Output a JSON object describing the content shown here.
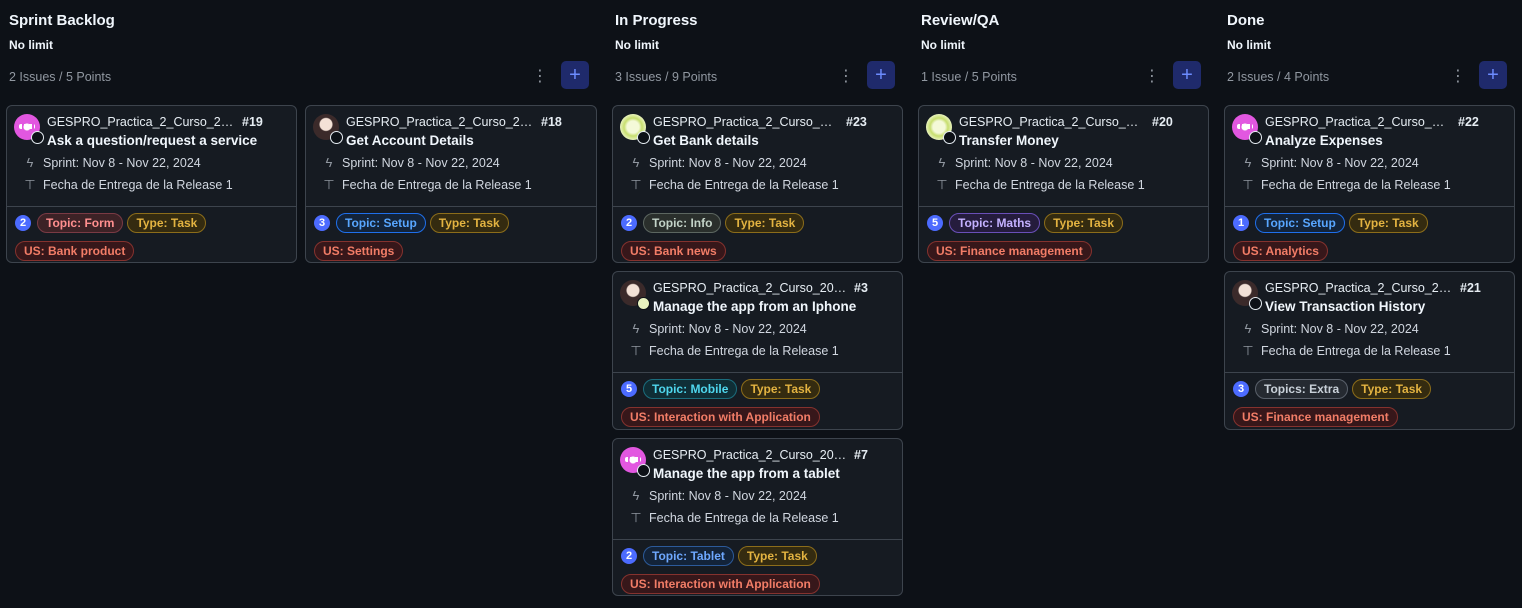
{
  "columns": [
    {
      "title": "Sprint Backlog",
      "limit": "No limit",
      "count": "2 Issues / 5 Points",
      "menu_icon": "kebab-menu-icon",
      "add_icon": "plus-icon",
      "cards": [
        {
          "repo": "GESPRO_Practica_2_Curso_202...",
          "number": "#19",
          "title": "Ask a question/request a service",
          "sprint": "Sprint: Nov 8 - Nov 22, 2024",
          "release": "Fecha de Entrega de la Release 1",
          "points": "2",
          "topic": "Topic: Form",
          "type": "Type: Task",
          "us": "US: Bank product"
        },
        {
          "repo": "GESPRO_Practica_2_Curso_202...",
          "number": "#18",
          "title": "Get Account Details",
          "sprint": "Sprint: Nov 8 - Nov 22, 2024",
          "release": "Fecha de Entrega de la Release 1",
          "points": "3",
          "topic": "Topic: Setup",
          "type": "Type: Task",
          "us": "US: Settings"
        }
      ]
    },
    {
      "title": "In Progress",
      "limit": "No limit",
      "count": "3 Issues / 9 Points",
      "cards": [
        {
          "repo": "GESPRO_Practica_2_Curso_20...",
          "number": "#23",
          "title": "Get Bank details",
          "sprint": "Sprint: Nov 8 - Nov 22, 2024",
          "release": "Fecha de Entrega de la Release 1",
          "points": "2",
          "topic": "Topic: Info",
          "type": "Type: Task",
          "us": "US: Bank news"
        },
        {
          "repo": "GESPRO_Practica_2_Curso_2024...",
          "number": "#3",
          "title": "Manage the app from an Iphone",
          "sprint": "Sprint: Nov 8 - Nov 22, 2024",
          "release": "Fecha de Entrega de la Release 1",
          "points": "5",
          "topic": "Topic: Mobile",
          "type": "Type: Task",
          "us": "US: Interaction with Application"
        },
        {
          "repo": "GESPRO_Practica_2_Curso_2024...",
          "number": "#7",
          "title": "Manage the app from a tablet",
          "sprint": "Sprint: Nov 8 - Nov 22, 2024",
          "release": "Fecha de Entrega de la Release 1",
          "points": "2",
          "topic": "Topic: Tablet",
          "type": "Type: Task",
          "us": "US: Interaction with Application"
        }
      ]
    },
    {
      "title": "Review/QA",
      "limit": "No limit",
      "count": "1 Issue / 5 Points",
      "cards": [
        {
          "repo": "GESPRO_Practica_2_Curso_20...",
          "number": "#20",
          "title": "Transfer Money",
          "sprint": "Sprint: Nov 8 - Nov 22, 2024",
          "release": "Fecha de Entrega de la Release 1",
          "points": "5",
          "topic": "Topic: Maths",
          "type": "Type: Task",
          "us": "US: Finance management"
        }
      ]
    },
    {
      "title": "Done",
      "limit": "No limit",
      "count": "2 Issues / 4 Points",
      "cards": [
        {
          "repo": "GESPRO_Practica_2_Curso_20...",
          "number": "#22",
          "title": "Analyze Expenses",
          "sprint": "Sprint: Nov 8 - Nov 22, 2024",
          "release": "Fecha de Entrega de la Release 1",
          "points": "1",
          "topic": "Topic: Setup",
          "type": "Type: Task",
          "us": "US: Analytics"
        },
        {
          "repo": "GESPRO_Practica_2_Curso_202...",
          "number": "#21",
          "title": "View Transaction History",
          "sprint": "Sprint: Nov 8 - Nov 22, 2024",
          "release": "Fecha de Entrega de la Release 1",
          "points": "3",
          "topic": "Topics: Extra",
          "type": "Type: Task",
          "us": "US: Finance management"
        }
      ]
    }
  ],
  "colors": {
    "background": "#0d1117",
    "card": "#161b22",
    "accent": "#4c6bff"
  }
}
